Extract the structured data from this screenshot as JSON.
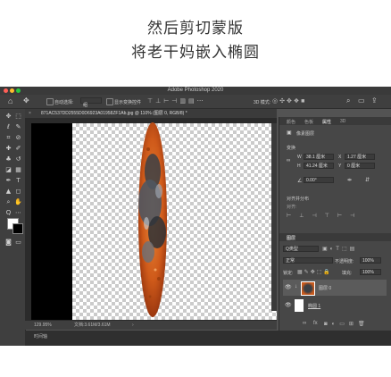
{
  "captions": {
    "line1": "然后剪切蒙版",
    "line2": "将老干妈嵌入椭圆"
  },
  "app": {
    "title": "Adobe Photoshop 2020",
    "traffic_colors": [
      "#ff5f57",
      "#febc2e",
      "#28c840"
    ]
  },
  "options_bar": {
    "auto_select": "自动选择:",
    "group_value": "组",
    "show_transform": "显示变换控件",
    "mode_3d": "3D 模式:"
  },
  "document_tab": {
    "label": "871AC537DD2555D0D6923A01958ZF1Ab.jpg @ 110% (图层 0, RGB/8) *"
  },
  "status_bar": {
    "zoom": "129.95%",
    "doc_info": "文档:3.61M/3.61M"
  },
  "timeline": {
    "label": "时间轴"
  },
  "properties_panel": {
    "tabs": [
      "颜色",
      "色板",
      "属性",
      "3D"
    ],
    "active_tab": "属性",
    "layer_type": "像素图层",
    "transform_title": "变换",
    "w_label": "W",
    "w_value": "38.1 厘米",
    "h_label": "H",
    "h_value": "41.24 厘米",
    "x_label": "X",
    "x_value": "1.27 厘米",
    "y_label": "Y",
    "y_value": "0 厘米",
    "angle_value": "0.00°",
    "align_title": "对齐并分布",
    "align_sub": "对齐:"
  },
  "layers_panel": {
    "tabs": [
      "图层"
    ],
    "kind_filter": "Q类型",
    "blend_mode": "正常",
    "opacity_label": "不透明度:",
    "opacity_value": "100%",
    "lock_label": "锁定:",
    "fill_label": "填充:",
    "fill_value": "100%",
    "layers": [
      {
        "name": "图层 0"
      },
      {
        "name": "椭圆 1"
      }
    ],
    "footer_fx": "fx"
  },
  "colors": {
    "ui_bg": "#535353",
    "panel_bg": "#474747",
    "toolbar_bg": "#3f3f3f",
    "accent": "#2a7fd4",
    "image_orange": "#d9621e"
  }
}
